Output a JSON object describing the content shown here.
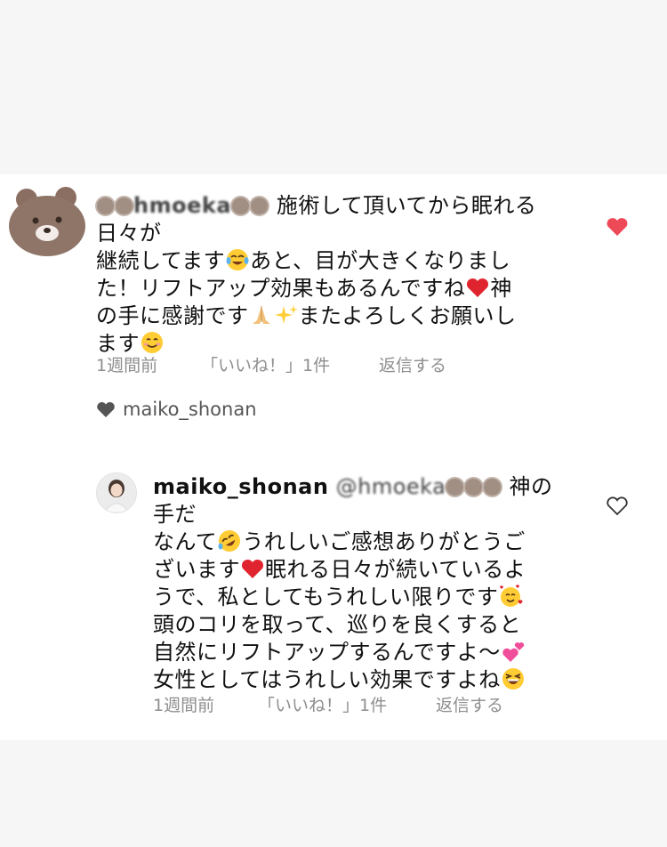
{
  "comment": {
    "username_obscured": "hmoeka",
    "line1_tail": "施術して頂いてから眠れる日々が",
    "line2a": "継続してます",
    "line2b": "あと、目が大きくなりまし",
    "line3a": "た！リフトアップ効果もあるんですね",
    "line3b": "神",
    "line4a": "の手に感謝です",
    "line4b": "またよろしくお願いし",
    "line5": "ます",
    "time": "1週間前",
    "likes": "「いいね！」1件",
    "reply": "返信する",
    "liked": true
  },
  "liked_by": {
    "name": "maiko_shonan"
  },
  "reply_comment": {
    "username": "maiko_shonan",
    "mention_obscured": "@hmoeka",
    "line1_tail": "神の手だ",
    "line2a": "なんて",
    "line2b": "うれしいご感想ありがとうご",
    "line3a": "ざいます",
    "line3b": "眠れる日々が続いているよ",
    "line4": "うで、私としてもうれしい限りです",
    "line5": "頭のコリを取って、巡りを良くすると",
    "line6": "自然にリフトアップするんですよ〜",
    "line7": "女性としてはうれしい効果ですよね",
    "time": "1週間前",
    "likes": "「いいね！」1件",
    "reply": "返信する",
    "liked": false
  },
  "colors": {
    "like_red": "#ed4956",
    "meta_gray": "#8e8e8e"
  }
}
